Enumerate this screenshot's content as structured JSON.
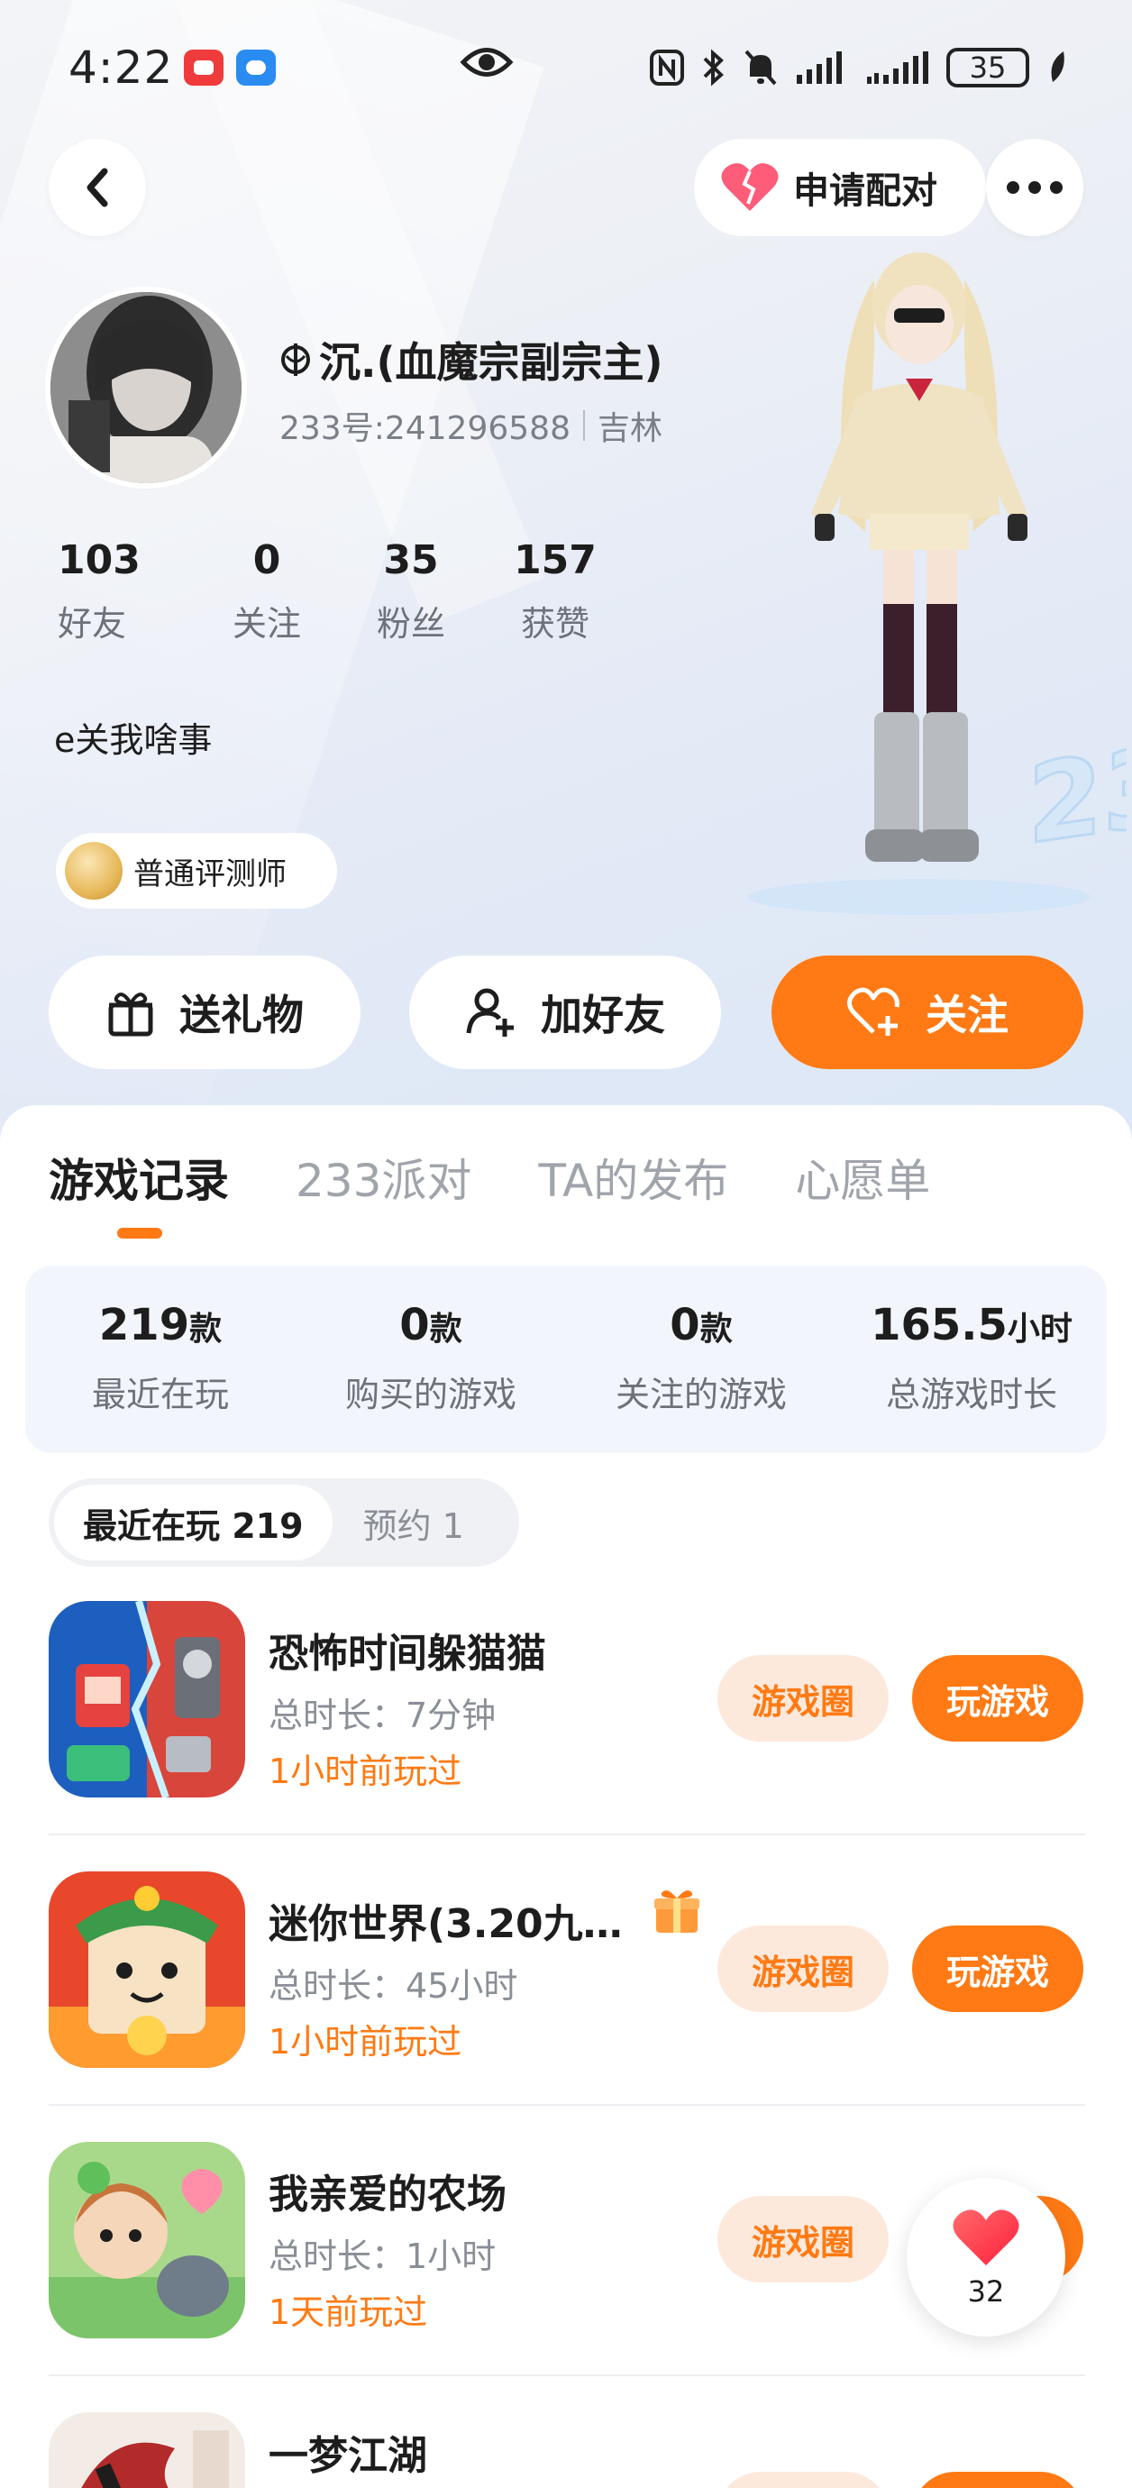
{
  "status_bar": {
    "time": "4:22",
    "battery": "35"
  },
  "header": {
    "pair_label": "申请配对"
  },
  "profile": {
    "name": "沉.(血魔宗副宗主)",
    "id_text": "233号:241296588",
    "location": "吉林",
    "stats": [
      {
        "value": "103",
        "label": "好友"
      },
      {
        "value": "0",
        "label": "关注"
      },
      {
        "value": "35",
        "label": "粉丝"
      },
      {
        "value": "157",
        "label": "获赞"
      }
    ],
    "bio": "e关我啥事",
    "badge": "普通评测师"
  },
  "actions": {
    "gift": "送礼物",
    "add_friend": "加好友",
    "follow": "关注"
  },
  "tabs": [
    "游戏记录",
    "233派对",
    "TA的发布",
    "心愿单"
  ],
  "summary": [
    {
      "value": "219",
      "unit": "款",
      "label": "最近在玩"
    },
    {
      "value": "0",
      "unit": "款",
      "label": "购买的游戏"
    },
    {
      "value": "0",
      "unit": "款",
      "label": "关注的游戏"
    },
    {
      "value": "165.5",
      "unit": "小时",
      "label": "总游戏时长"
    }
  ],
  "segments": {
    "recent": "最近在玩 219",
    "reserve": "预约 1"
  },
  "games": [
    {
      "title": "恐怖时间躲猫猫",
      "duration": "总时长：7分钟",
      "last_played": "1小时前玩过",
      "circle_btn": "游戏圈",
      "play_btn": "玩游戏"
    },
    {
      "title": "迷你世界(3.20九…",
      "duration": "总时长：45小时",
      "last_played": "1小时前玩过",
      "circle_btn": "游戏圈",
      "play_btn": "玩游戏"
    },
    {
      "title": "我亲爱的农场",
      "duration": "总时长：1小时",
      "last_played": "1天前玩过",
      "circle_btn": "游戏圈",
      "play_btn": "玩游戏"
    },
    {
      "title": "一梦江湖",
      "duration": "",
      "last_played": "",
      "circle_btn": "",
      "play_btn": ""
    }
  ],
  "like_float": {
    "count": "32"
  }
}
